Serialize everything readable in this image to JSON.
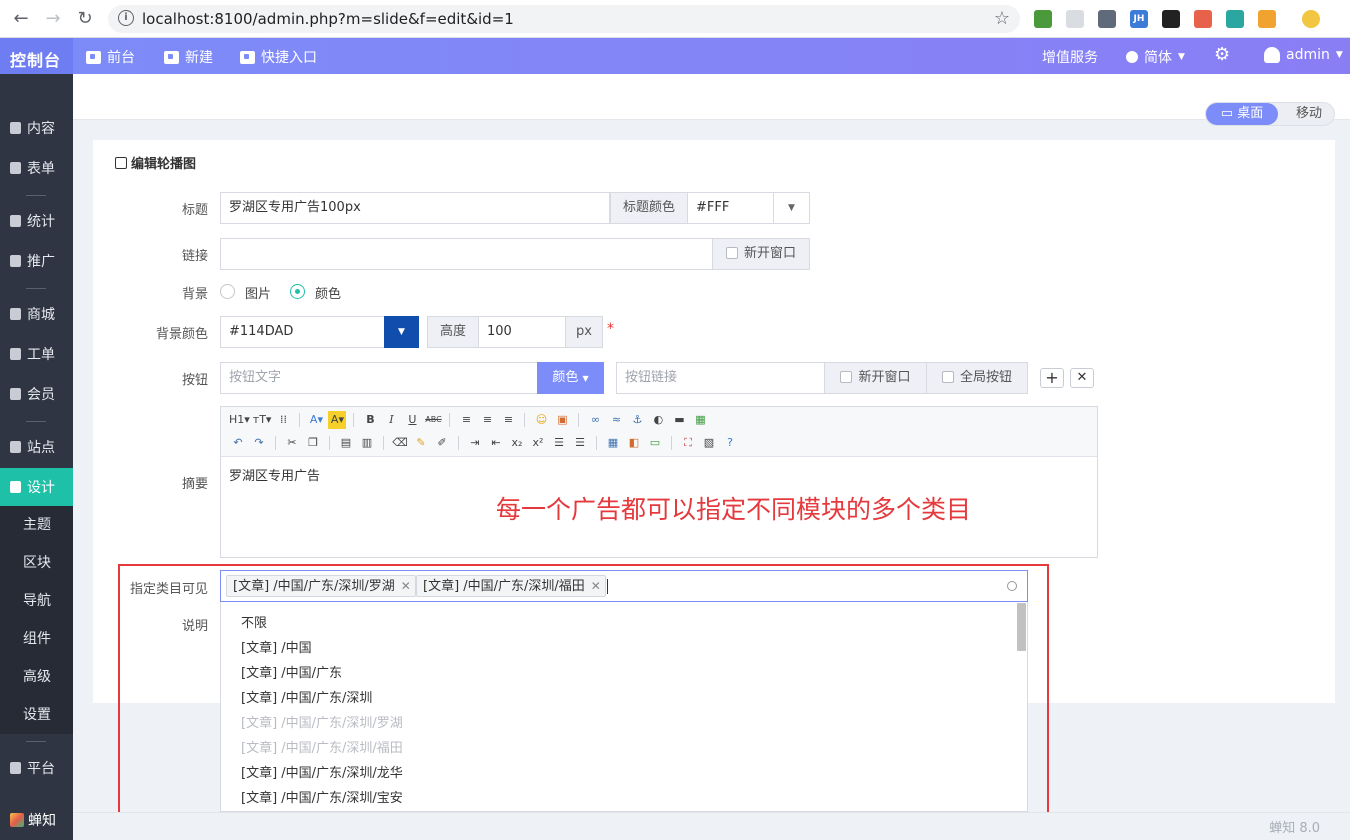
{
  "browser": {
    "url": "localhost:8100/admin.php?m=slide&f=edit&id=1",
    "extensions": [
      {
        "name": "globe-extension-icon",
        "color": "#4a9a3c",
        "label": ""
      },
      {
        "name": "grid-extension-icon",
        "color": "#d9dce1",
        "label": ""
      },
      {
        "name": "vue-extension-icon",
        "color": "#5f6b7a",
        "label": ""
      },
      {
        "name": "jh-extension-icon",
        "color": "#3d7bd8",
        "label": "JH"
      },
      {
        "name": "mask-extension-icon",
        "color": "#222222",
        "label": ""
      },
      {
        "name": "share-extension-icon",
        "color": "#e8614a",
        "label": ""
      },
      {
        "name": "clock-extension-icon",
        "color": "#2aa7a0",
        "label": ""
      },
      {
        "name": "rss-extension-icon",
        "color": "#f0a32e",
        "label": ""
      },
      {
        "name": "profile-avatar-icon",
        "color": "#f2c640",
        "label": ""
      }
    ]
  },
  "header": {
    "logo": "控制台",
    "front": "前台",
    "new": "新建",
    "shortcut": "快捷入口",
    "value_service": "增值服务",
    "language": "简体",
    "user": "admin"
  },
  "sidebar": {
    "items": [
      "内容",
      "表单",
      "统计",
      "推广",
      "商城",
      "工单",
      "会员",
      "站点",
      "设计"
    ],
    "sub_items": [
      "主题",
      "区块",
      "导航",
      "组件",
      "高级",
      "设置"
    ],
    "platform": "平台",
    "brand": "蝉知"
  },
  "view_toggle": {
    "desktop": "桌面",
    "mobile": "移动"
  },
  "form": {
    "panel_title": "编辑轮播图",
    "title_label": "标题",
    "title_value": "罗湖区专用广告100px",
    "title_color_label": "标题颜色",
    "title_color_value": "#FFF",
    "link_label": "链接",
    "link_value": "",
    "new_window": "新开窗口",
    "bg_label": "背景",
    "bg_image": "图片",
    "bg_color_opt": "颜色",
    "bg_color_label": "背景颜色",
    "bg_color_value": "#114DAD",
    "height_label": "高度",
    "height_value": "100",
    "height_unit": "px",
    "required_mark": "*",
    "button_label": "按钮",
    "button_text_ph": "按钮文字",
    "button_color": "颜色",
    "button_link_ph": "按钮链接",
    "button_new_window": "新开窗口",
    "global_button": "全局按钮",
    "add": "+",
    "remove": "✕",
    "summary_label": "摘要",
    "summary_value": "罗湖区专用广告",
    "category_label": "指定类目可见",
    "note_label": "说明",
    "selected_tags": [
      "[文章] /中国/广东/深圳/罗湖",
      "[文章] /中国/广东/深圳/福田"
    ],
    "options": [
      {
        "label": "不限",
        "disabled": false
      },
      {
        "label": "[文章] /中国",
        "disabled": false
      },
      {
        "label": "[文章] /中国/广东",
        "disabled": false
      },
      {
        "label": "[文章] /中国/广东/深圳",
        "disabled": false
      },
      {
        "label": "[文章] /中国/广东/深圳/罗湖",
        "disabled": true
      },
      {
        "label": "[文章] /中国/广东/深圳/福田",
        "disabled": true
      },
      {
        "label": "[文章] /中国/广东/深圳/龙华",
        "disabled": false
      },
      {
        "label": "[文章] /中国/广东/深圳/宝安",
        "disabled": false
      }
    ]
  },
  "annotation": "每一个广告都可以指定不同模块的多个类目",
  "version": "蝉知 8.0",
  "colors": {
    "accent": "#7c8cf8",
    "active_green": "#1ec0a8",
    "bg_color_swatch": "#114DAD",
    "annotation_red": "#e5393d"
  }
}
